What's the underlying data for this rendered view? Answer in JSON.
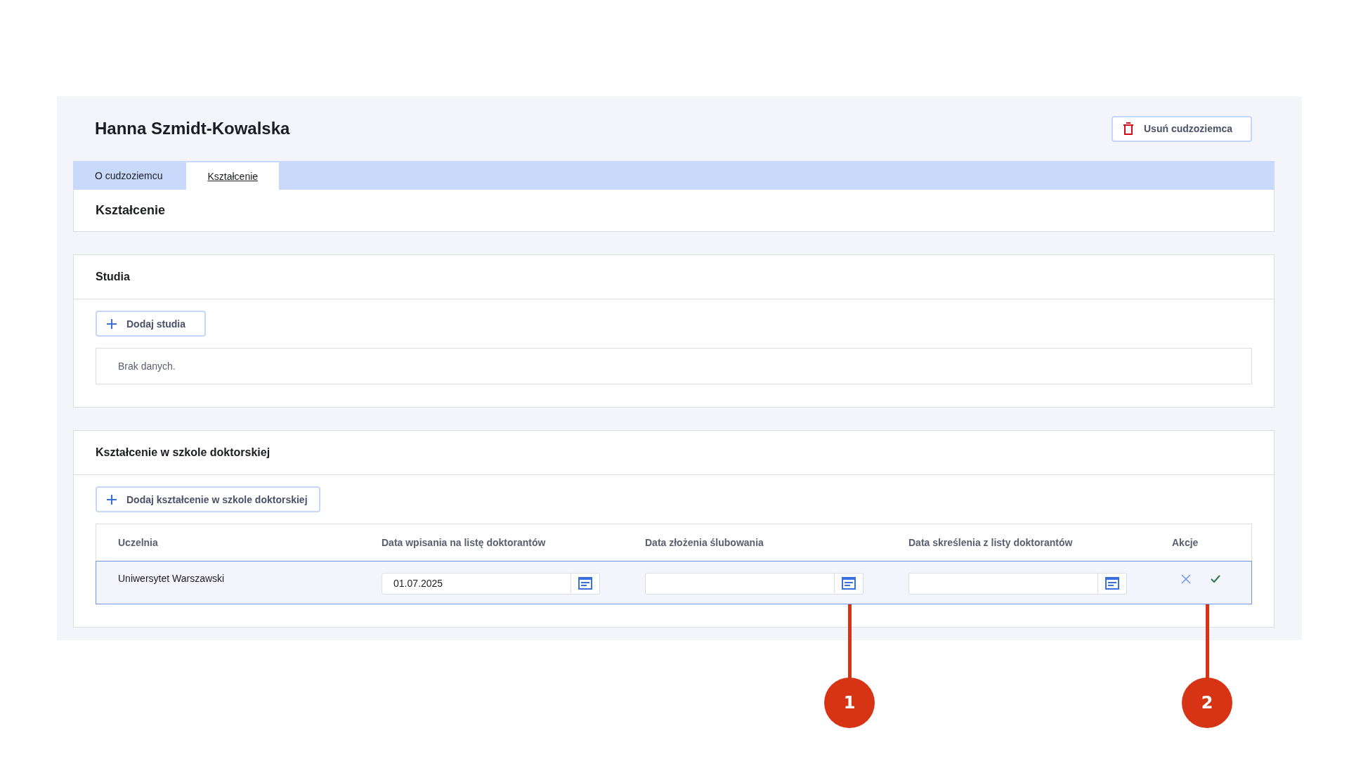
{
  "page": {
    "title": "Hanna Szmidt-Kowalska",
    "delete_button": "Usuń cudzoziemca"
  },
  "tabs": [
    {
      "label": "O cudzoziemcu",
      "selected": false
    },
    {
      "label": "Kształcenie",
      "selected": true
    }
  ],
  "section_heading": "Kształcenie",
  "studia": {
    "title": "Studia",
    "add_button": "Dodaj studia",
    "empty_text": "Brak danych."
  },
  "doctoral": {
    "title": "Kształcenie w szkole doktorskiej",
    "add_button": "Dodaj kształcenie w szkole doktorskiej",
    "table": {
      "columns": [
        "Uczelnia",
        "Data wpisania na listę doktorantów",
        "Data złożenia ślubowania",
        "Data skreślenia z listy doktorantów",
        "Akcje"
      ],
      "rows": [
        {
          "selected": true,
          "cells": [
            {
              "kind": "text",
              "value": "Uniwersytet Warszawski"
            },
            {
              "kind": "date",
              "value": "01.07.2025"
            },
            {
              "kind": "date",
              "callout": "1"
            },
            {
              "kind": "date"
            },
            {
              "kind": "actions",
              "callout": "2"
            }
          ]
        }
      ]
    }
  }
}
